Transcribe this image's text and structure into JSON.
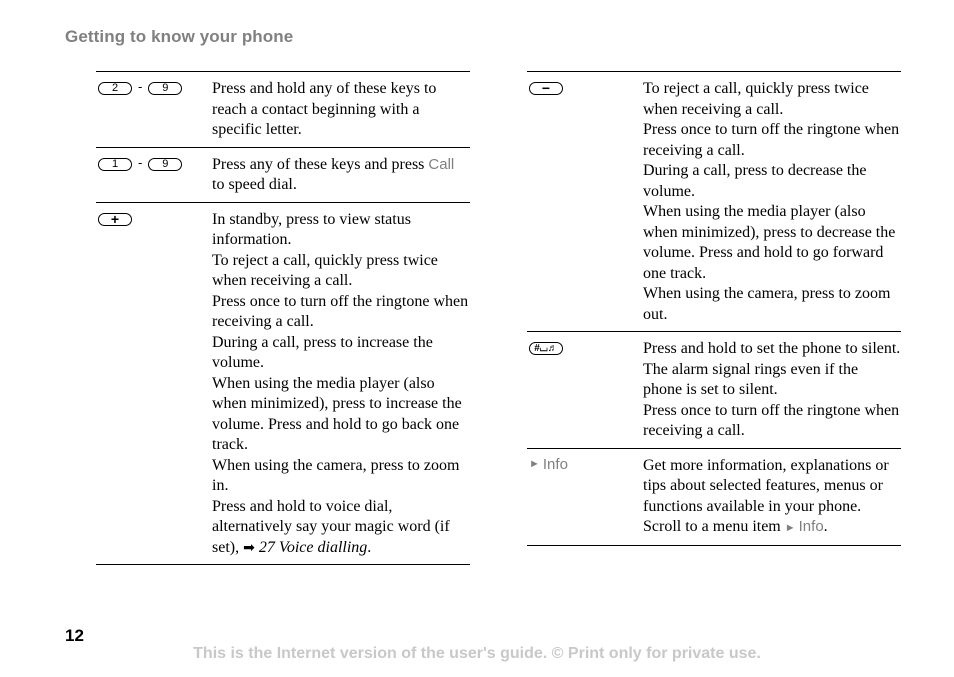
{
  "header": {
    "title": "Getting to know your phone"
  },
  "left_column": {
    "rows": [
      {
        "keys": [
          "2",
          "9"
        ],
        "separator": "-",
        "description": [
          "Press and hold any of these keys to reach a contact beginning with a specific letter."
        ]
      },
      {
        "keys": [
          "1",
          "9"
        ],
        "separator": "-",
        "description_parts": {
          "before": "Press any of these keys and press ",
          "highlight": "Call",
          "after": " to speed dial."
        }
      },
      {
        "keys": [
          "+"
        ],
        "description": [
          "In standby, press to view status information.",
          "To reject a call, quickly press twice when receiving a call.",
          "Press once to turn off the ringtone when receiving a call.",
          "During a call, press to increase the volume.",
          "When using the media player (also when minimized), press to increase the volume. Press and hold to go back one track.",
          "When using the camera, press to zoom in."
        ],
        "last_line": {
          "before": "Press and hold to voice dial, alternatively say your magic word (if set), ",
          "arrow_icon": "➡",
          "reference": "27 Voice dialling",
          "after": "."
        }
      }
    ]
  },
  "right_column": {
    "rows": [
      {
        "keys": [
          "−"
        ],
        "description": [
          "To reject a call, quickly press twice when receiving a call.",
          "Press once to turn off the ringtone when receiving a call.",
          "During a call, press to decrease the volume.",
          "When using the media player (also when minimized), press to decrease the volume. Press and hold to go forward one track.",
          "When using the camera, press to zoom out."
        ]
      },
      {
        "keys": [
          "#⌴♬"
        ],
        "description": [
          "Press and hold to set the phone to silent. The alarm signal rings even if the phone is set to silent.",
          "Press once to turn off the ringtone when receiving a call."
        ]
      },
      {
        "menu_label": "Info",
        "menu_marker": "►",
        "description_parts": {
          "before": "Get more information, explanations or tips about selected features, menus or functions available in your phone. Scroll to a menu item ",
          "marker": "►",
          "highlight": "Info",
          "after": "."
        }
      }
    ]
  },
  "footer": {
    "page_number": "12",
    "note": "This is the Internet version of the user's guide. © Print only for private use."
  }
}
